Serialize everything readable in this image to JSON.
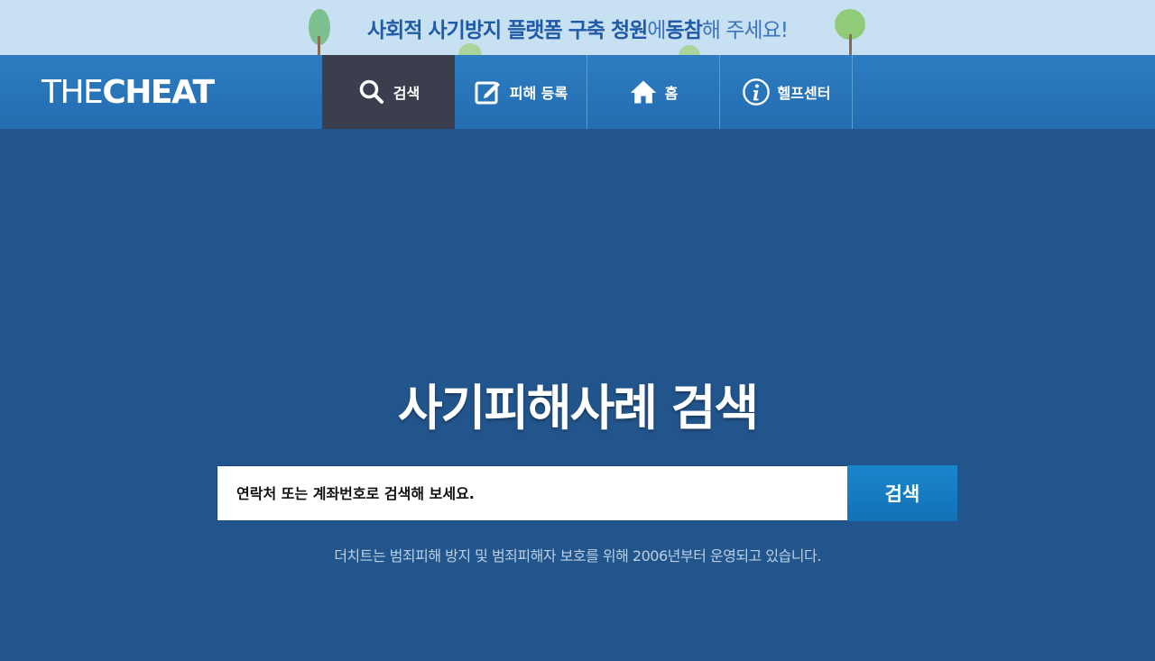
{
  "banner": {
    "parts": [
      {
        "text": "사회적 사기방지 플랫폼 구축 청원",
        "style": "bold"
      },
      {
        "text": "에 ",
        "style": "normal"
      },
      {
        "text": "동참",
        "style": "bold"
      },
      {
        "text": "해 주세요!",
        "style": "normal"
      }
    ],
    "colors": {
      "background": "#c7e0f2",
      "text": "#2a64b3"
    }
  },
  "logo": {
    "thin": "THE",
    "bold": "CHEAT"
  },
  "nav": {
    "items": [
      {
        "label": "검색",
        "icon": "search-icon",
        "active": true
      },
      {
        "label": "피해 등록",
        "icon": "edit-icon",
        "active": false
      },
      {
        "label": "홈",
        "icon": "home-icon",
        "active": false
      },
      {
        "label": "헬프센터",
        "icon": "info-icon",
        "active": false
      }
    ]
  },
  "main": {
    "headline": "사기피해사례 검색",
    "search": {
      "placeholder": "연락처 또는 계좌번호로 검색해 보세요.",
      "value": ""
    },
    "search_button": "검색",
    "notice": "더치트는 범죄피해 방지 및 범죄피해자 보호를 위해 2006년부터 운영되고 있습니다."
  },
  "colors": {
    "page_background": "#22558c",
    "navbar": "#2a77bd",
    "active_tab": "#3b3e4d",
    "search_button": "#1a7fc4"
  }
}
